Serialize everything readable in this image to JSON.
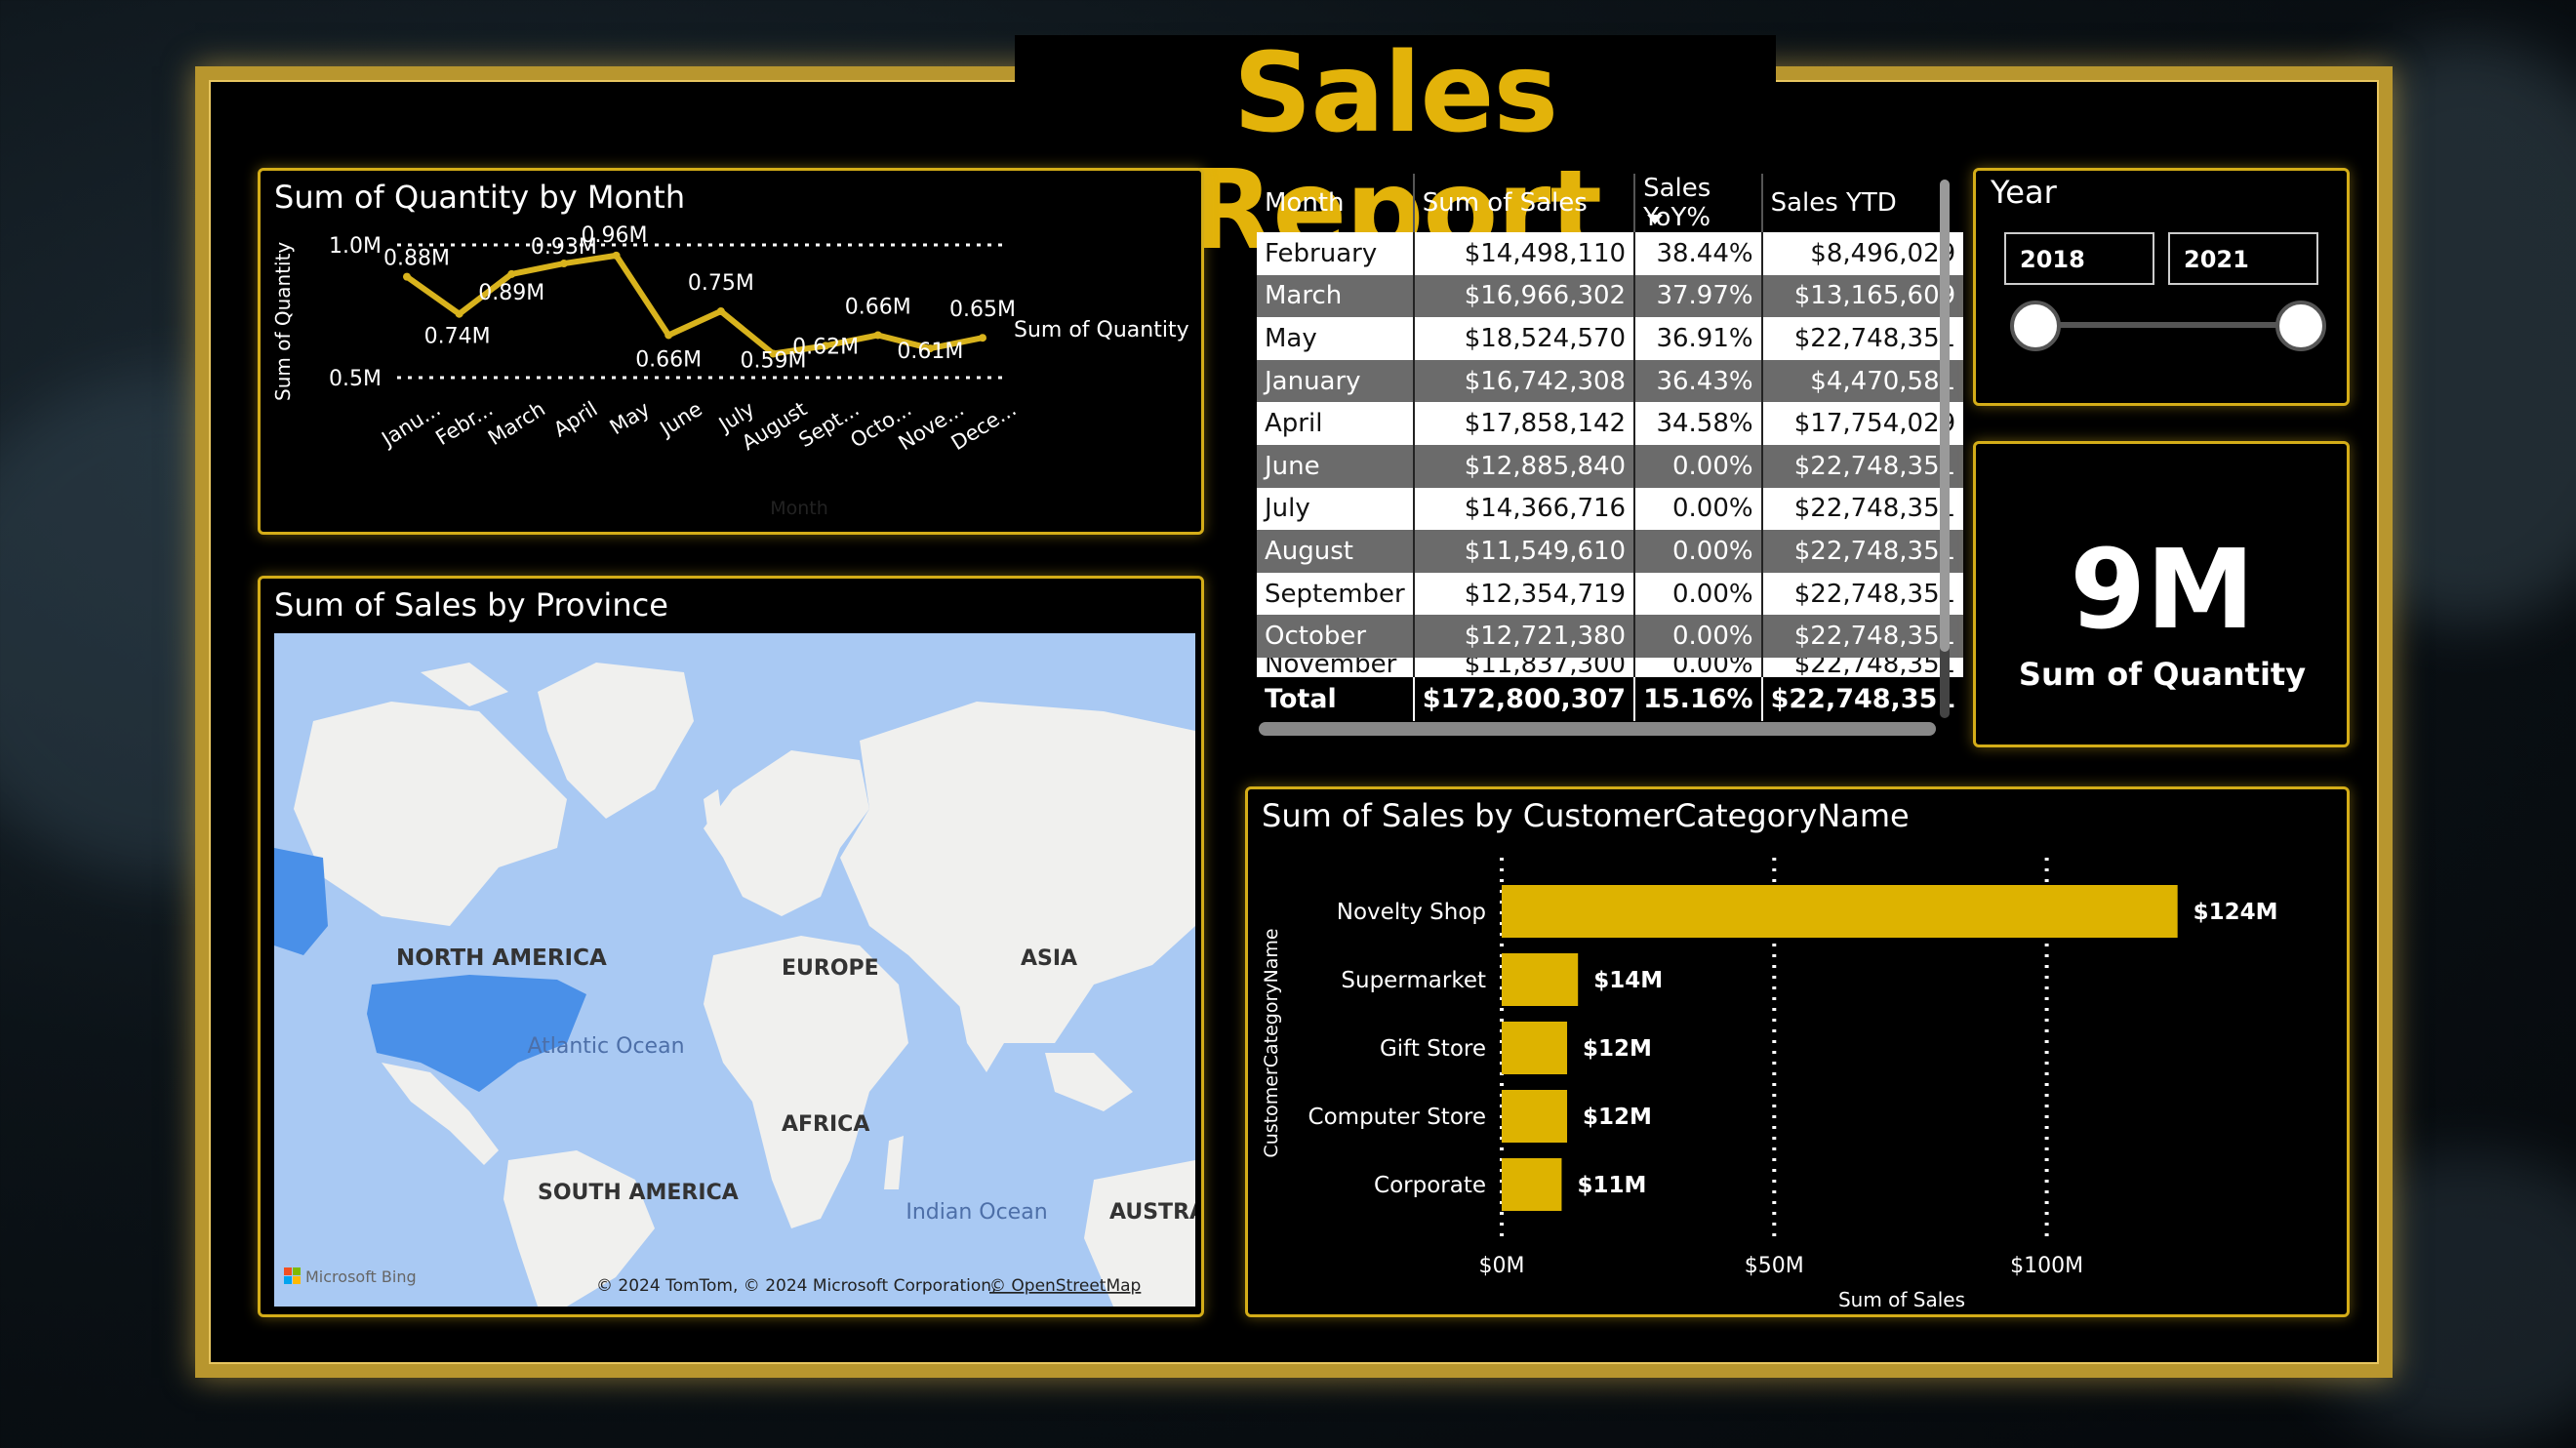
{
  "page": {
    "title": "Sales Report"
  },
  "colors": {
    "accent": "#e3b30a",
    "line": "#d8b31d",
    "bar": "#ddb300",
    "map_water": "#a9c9f3",
    "map_land": "#f0f0ee",
    "map_highlight": "#4a90e8"
  },
  "line_panel": {
    "title": "Sum of Quantity by Month"
  },
  "map_panel": {
    "title": "Sum of Sales by Province",
    "labels": {
      "north_america": "NORTH AMERICA",
      "europe": "EUROPE",
      "asia": "ASIA",
      "africa": "AFRICA",
      "south_america": "SOUTH AMERICA",
      "atlantic": "Atlantic Ocean",
      "indian": "Indian Ocean",
      "australia": "AUSTRA"
    },
    "brand": "Microsoft Bing",
    "copyright": "© 2024 TomTom, © 2024 Microsoft Corporation,",
    "osm_link": "© OpenStreetMap"
  },
  "table": {
    "headers": [
      "Month",
      "Sum of Sales",
      "Sales YoY%",
      "Sales YTD"
    ],
    "rows": [
      [
        "February",
        "$14,498,110",
        "38.44%",
        "$8,496,029"
      ],
      [
        "March",
        "$16,966,302",
        "37.97%",
        "$13,165,609"
      ],
      [
        "May",
        "$18,524,570",
        "36.91%",
        "$22,748,351"
      ],
      [
        "January",
        "$16,742,308",
        "36.43%",
        "$4,470,581"
      ],
      [
        "April",
        "$17,858,142",
        "34.58%",
        "$17,754,029"
      ],
      [
        "June",
        "$12,885,840",
        "0.00%",
        "$22,748,351"
      ],
      [
        "July",
        "$14,366,716",
        "0.00%",
        "$22,748,351"
      ],
      [
        "August",
        "$11,549,610",
        "0.00%",
        "$22,748,351"
      ],
      [
        "September",
        "$12,354,719",
        "0.00%",
        "$22,748,351"
      ],
      [
        "October",
        "$12,721,380",
        "0.00%",
        "$22,748,351"
      ]
    ],
    "partial_row": [
      "November",
      "$11,837,300",
      "0.00%",
      "$22,748,351"
    ],
    "total": [
      "Total",
      "$172,800,307",
      "15.16%",
      "$22,748,351"
    ]
  },
  "slicer": {
    "label": "Year",
    "from": "2018",
    "to": "2021"
  },
  "kpi": {
    "value": "9M",
    "label": "Sum of Quantity"
  },
  "bar_panel": {
    "title": "Sum of Sales by CustomerCategoryName"
  },
  "chart_data": [
    {
      "type": "line",
      "title": "Sum of Quantity by Month",
      "xlabel": "Month",
      "ylabel": "Sum of Quantity",
      "legend": "Sum of Quantity",
      "categories": [
        "Janu...",
        "Febr...",
        "March",
        "April",
        "May",
        "June",
        "July",
        "August",
        "Sept...",
        "Octo...",
        "Nove...",
        "Dece..."
      ],
      "series": [
        {
          "name": "Sum of Quantity",
          "values": [
            0.88,
            0.74,
            0.89,
            0.93,
            0.96,
            0.66,
            0.75,
            0.59,
            0.62,
            0.66,
            0.61,
            0.65
          ]
        }
      ],
      "value_labels": [
        "0.88M",
        "0.74M",
        "0.89M",
        "0.93M",
        "0.96M",
        "0.66M",
        "0.75M",
        "0.59M",
        "0.62M",
        "0.66M",
        "0.61M",
        "0.65M"
      ],
      "yticks": [
        {
          "value": 0.5,
          "label": "0.5M"
        },
        {
          "value": 1.0,
          "label": "1.0M"
        }
      ],
      "ylim": [
        0.5,
        1.0
      ],
      "grid": true
    },
    {
      "type": "bar",
      "orientation": "horizontal",
      "title": "Sum of Sales by CustomerCategoryName",
      "xlabel": "Sum of Sales",
      "ylabel": "CustomerCategoryName",
      "categories": [
        "Novelty Shop",
        "Supermarket",
        "Gift Store",
        "Computer Store",
        "Corporate"
      ],
      "values": [
        124,
        14,
        12,
        12,
        11
      ],
      "value_labels": [
        "$124M",
        "$14M",
        "$12M",
        "$12M",
        "$11M"
      ],
      "xticks": [
        {
          "value": 0,
          "label": "$0M"
        },
        {
          "value": 50,
          "label": "$50M"
        },
        {
          "value": 100,
          "label": "$100M"
        }
      ],
      "xlim": [
        0,
        124
      ],
      "grid": true
    }
  ]
}
